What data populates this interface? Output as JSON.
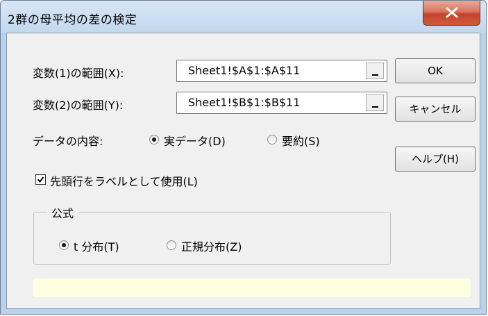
{
  "window": {
    "title": "2群の母平均の差の検定",
    "close_symbol": "X"
  },
  "range1": {
    "label": "変数(1)の範囲(X):",
    "value": "Sheet1!$A$1:$A$11"
  },
  "range2": {
    "label": "変数(2)の範囲(Y):",
    "value": "Sheet1!$B$1:$B$11"
  },
  "buttons": {
    "ok": "OK",
    "cancel": "キャンセル",
    "help": "ヘルプ(H)"
  },
  "data_type": {
    "label": "データの内容:",
    "options": [
      {
        "label": "実データ(D)",
        "checked": true
      },
      {
        "label": "要約(S)",
        "checked": false
      }
    ]
  },
  "header_checkbox": {
    "label": "先頭行をラベルとして使用(L)",
    "checked": true
  },
  "formula": {
    "legend": "公式",
    "options": [
      {
        "label": "t 分布(T)",
        "checked": true
      },
      {
        "label": "正規分布(Z)",
        "checked": false
      }
    ]
  },
  "status_message": "",
  "colors": {
    "titlebar": "#c9dcf0",
    "close_button": "#c4442a",
    "client_background": "#f0f0f0",
    "status_background": "#ffffe1"
  }
}
